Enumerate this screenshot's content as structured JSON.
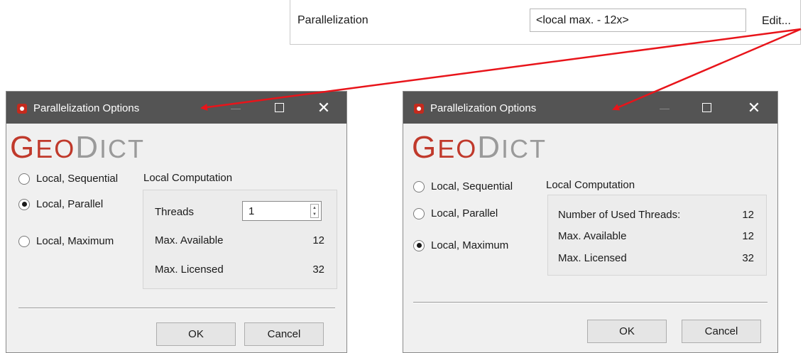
{
  "property": {
    "label": "Parallelization",
    "value": "<local max. - 12x>",
    "edit_label": "Edit..."
  },
  "left_dialog": {
    "title": "Parallelization Options",
    "logo": {
      "first": "G",
      "rest_red": "EO",
      "second": "D",
      "rest_gray": "ICT"
    },
    "radios": [
      {
        "label": "Local, Sequential",
        "selected": false
      },
      {
        "label": "Local, Parallel",
        "selected": true
      },
      {
        "label": "Local, Maximum",
        "selected": false
      }
    ],
    "group_title": "Local Computation",
    "threads_label": "Threads",
    "threads_value": "1",
    "max_available_label": "Max. Available",
    "max_available_value": "12",
    "max_licensed_label": "Max. Licensed",
    "max_licensed_value": "32",
    "ok_label": "OK",
    "cancel_label": "Cancel"
  },
  "right_dialog": {
    "title": "Parallelization Options",
    "logo": {
      "first": "G",
      "rest_red": "EO",
      "second": "D",
      "rest_gray": "ICT"
    },
    "radios": [
      {
        "label": "Local, Sequential",
        "selected": false
      },
      {
        "label": "Local, Parallel",
        "selected": false
      },
      {
        "label": "Local, Maximum",
        "selected": true
      }
    ],
    "group_title": "Local Computation",
    "used_threads_label": "Number of Used Threads:",
    "used_threads_value": "12",
    "max_available_label": "Max. Available",
    "max_available_value": "12",
    "max_licensed_label": "Max. Licensed",
    "max_licensed_value": "32",
    "ok_label": "OK",
    "cancel_label": "Cancel"
  },
  "colors": {
    "titlebar": "#545454",
    "arrow": "#e8141a",
    "logo_red": "#c0392b",
    "logo_gray": "#9a9a9a"
  }
}
